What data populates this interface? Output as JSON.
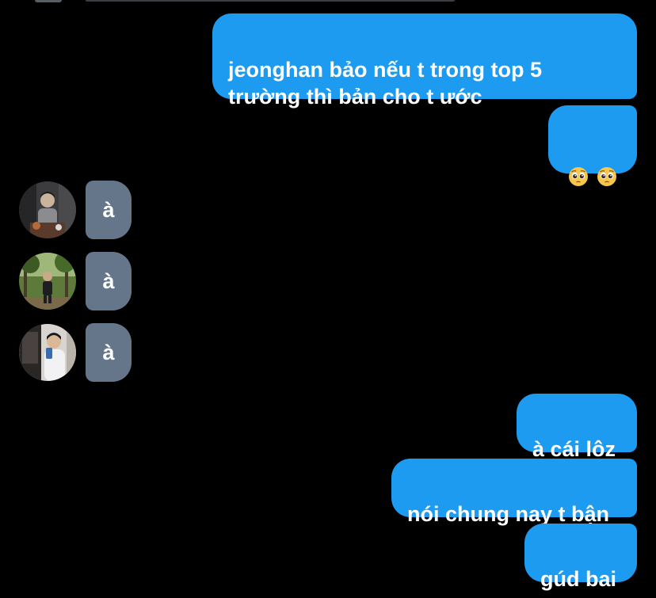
{
  "messages": {
    "sent_1": "jeonghan bảo nếu t trong top 5\ntrường thì bản cho t ước",
    "sent_2_emoji_icons": [
      "pleading-face-icon",
      "pleading-face-icon"
    ],
    "received": [
      {
        "text": "à"
      },
      {
        "text": "à"
      },
      {
        "text": "à"
      }
    ],
    "sent_3": "à cái lôz",
    "sent_4": "nói chung nay t bận",
    "sent_5": "gúd bai"
  },
  "colors": {
    "background": "#000000",
    "sent_bubble": "#1d9bf0",
    "received_bubble": "#66768a",
    "text": "#ffffff"
  }
}
